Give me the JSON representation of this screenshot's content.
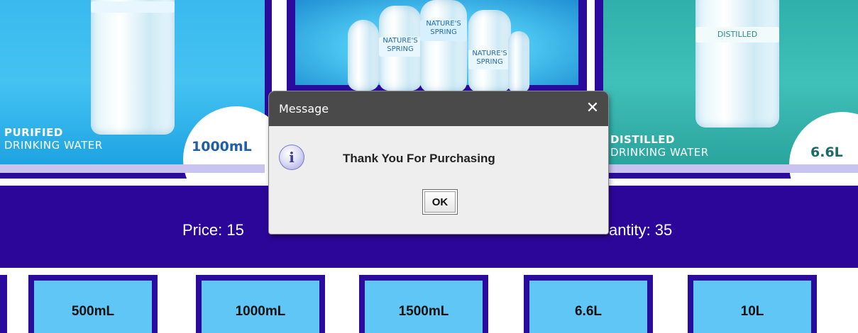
{
  "products": {
    "left": {
      "line1": "PURIFIED",
      "line2": "DRINKING WATER",
      "size": "1000mL"
    },
    "right": {
      "line1": "DISTILLED",
      "line2": "DRINKING WATER",
      "size": "6.6L",
      "bottle_label": "DISTILLED"
    },
    "center": {
      "bottle_labels": [
        "NATURE'S SPRING",
        "NATURE'S SPRING",
        "NATURE'S SPRING"
      ]
    }
  },
  "info_bar": {
    "price_text": "Price: 15",
    "quantity_text": "antity: 35"
  },
  "size_buttons": [
    {
      "label": "500mL"
    },
    {
      "label": "1000mL"
    },
    {
      "label": "1500mL"
    },
    {
      "label": "6.6L"
    },
    {
      "label": "10L"
    }
  ],
  "dialog": {
    "title": "Message",
    "close_glyph": "✕",
    "icon_glyph": "i",
    "message": "Thank You For Purchasing",
    "ok_label": "OK"
  },
  "colors": {
    "accent_purple": "#2c0698",
    "button_blue": "#60c6f6",
    "dialog_title_bar": "#4a4a4a"
  },
  "icons": {
    "dialog_icon": "info-icon",
    "close": "close-icon"
  }
}
